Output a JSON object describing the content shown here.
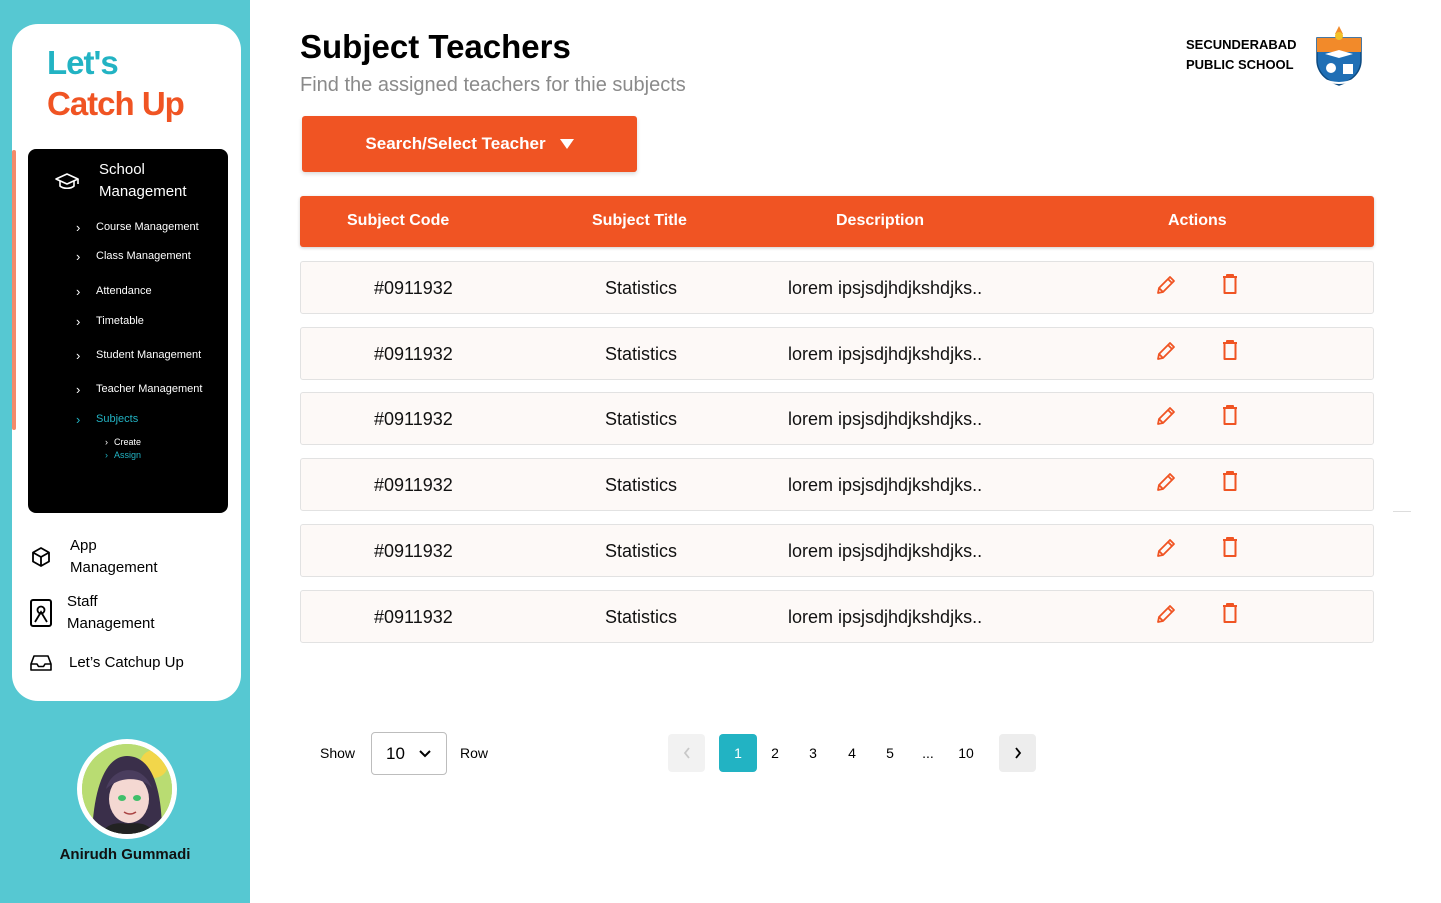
{
  "brand": {
    "line1": "Let's",
    "line2": "Catch Up"
  },
  "sidebar": {
    "section_title": "School Management",
    "items": [
      {
        "label": "Course Management"
      },
      {
        "label": "Class Management"
      },
      {
        "label": "Attendance"
      },
      {
        "label": "Timetable"
      },
      {
        "label": "Student Management"
      },
      {
        "label": "Teacher Management"
      },
      {
        "label": "Subjects",
        "active": true
      }
    ],
    "sub_items": [
      {
        "label": "Create"
      },
      {
        "label": "Assign",
        "active": true
      }
    ],
    "nav": [
      {
        "label": "App Management",
        "icon": "cube-icon"
      },
      {
        "label": "Staff Management",
        "icon": "id-badge-icon"
      },
      {
        "label": "Let’s Catchup Up",
        "icon": "inbox-icon"
      }
    ],
    "user_name": "Anirudh Gummadi"
  },
  "header": {
    "title": "Subject Teachers",
    "subtitle": "Find the assigned teachers for thie subjects",
    "school_line1": "SECUNDERABAD",
    "school_line2": "PUBLIC SCHOOL"
  },
  "select_button": {
    "label": "Search/Select Teacher"
  },
  "table": {
    "headers": [
      "Subject Code",
      "Subject Title",
      "Description",
      "Actions"
    ],
    "rows": [
      {
        "code": "#0911932",
        "title": "Statistics",
        "description": "lorem ipsjsdjhdjkshdjks.."
      },
      {
        "code": "#0911932",
        "title": "Statistics",
        "description": "lorem ipsjsdjhdjkshdjks.."
      },
      {
        "code": "#0911932",
        "title": "Statistics",
        "description": "lorem ipsjsdjhdjkshdjks.."
      },
      {
        "code": "#0911932",
        "title": "Statistics",
        "description": "lorem ipsjsdjhdjkshdjks.."
      },
      {
        "code": "#0911932",
        "title": "Statistics",
        "description": "lorem ipsjsdjhdjkshdjks.."
      },
      {
        "code": "#0911932",
        "title": "Statistics",
        "description": "lorem ipsjsdjhdjkshdjks.."
      }
    ]
  },
  "pagination": {
    "show_label": "Show",
    "rows_value": "10",
    "row_label": "Row",
    "pages": [
      "1",
      "2",
      "3",
      "4",
      "5",
      "...",
      "10"
    ],
    "current": "1"
  },
  "colors": {
    "accent": "#f05423",
    "teal": "#22b3c3",
    "sidebar_bg": "#56c8d2"
  }
}
